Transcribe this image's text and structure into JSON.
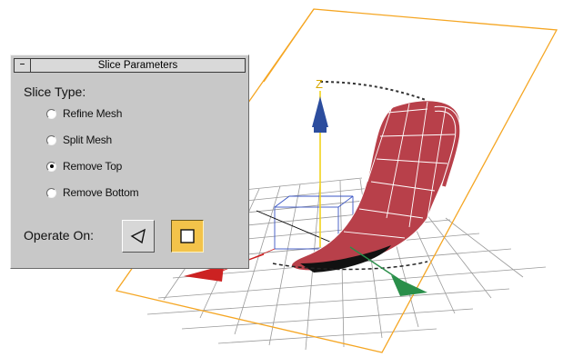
{
  "panel": {
    "collapse_symbol": "–",
    "title": "Slice Parameters",
    "slice_type_label": "Slice Type:",
    "options": [
      {
        "label": "Refine Mesh",
        "checked": false
      },
      {
        "label": "Split Mesh",
        "checked": false
      },
      {
        "label": "Remove Top",
        "checked": true
      },
      {
        "label": "Remove Bottom",
        "checked": false
      }
    ],
    "operate_on_label": "Operate On:",
    "operate_buttons": [
      {
        "icon": "face-triangle-icon",
        "active": false
      },
      {
        "icon": "object-square-icon",
        "active": true
      }
    ]
  },
  "viewport": {
    "axis_label": "Z",
    "colors": {
      "slice_plane": "#f5a623",
      "jug": "#b8404a",
      "grid": "#9a9a9a",
      "z_axis": "#f1d21b",
      "z_arrow": "#2c4d9e",
      "y_arrow": "#2a8f4a",
      "x_arrow": "#cc2222",
      "panel_bg": "#c8c8c8",
      "active_button": "#f3c34a"
    }
  }
}
